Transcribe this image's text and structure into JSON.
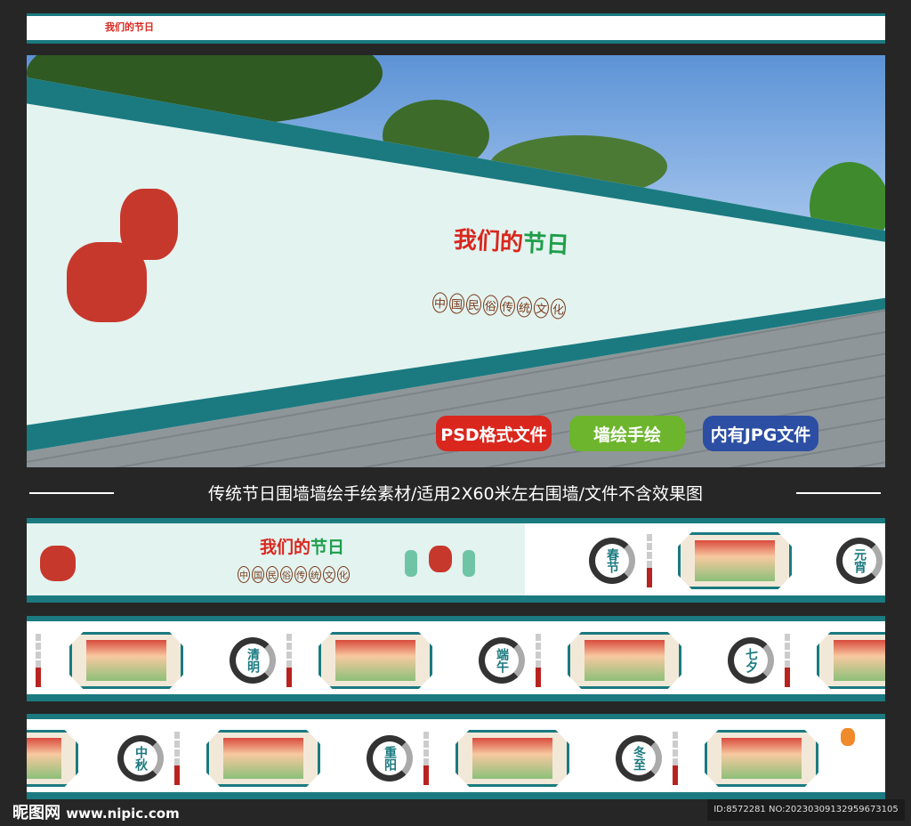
{
  "banner": {
    "title": "我们的节日",
    "title_part_red": "我们的",
    "title_part_green": "节日",
    "subtitle_chars": [
      "中",
      "国",
      "民",
      "俗",
      "传",
      "统",
      "文",
      "化"
    ]
  },
  "badges": [
    {
      "label": "PSD格式文件",
      "color": "#d9271e"
    },
    {
      "label": "墙绘手绘",
      "color": "#6cb52d"
    },
    {
      "label": "内有JPG文件",
      "color": "#2c4fa3"
    }
  ],
  "caption": "传统节日围墙墙绘手绘素材/适用2X60米左右围墙/文件不含效果图",
  "festivals": {
    "row1": [
      "春节",
      "元宵"
    ],
    "row2": [
      "清明",
      "端午",
      "七夕"
    ],
    "row3": [
      "中秋",
      "重阳",
      "冬至"
    ]
  },
  "footer": {
    "logo": "昵图网",
    "url": "www.nipic.com",
    "id_text": "ID:8572281 NO:20230309132959673105"
  },
  "colors": {
    "teal": "#1a7a80",
    "background": "#262626"
  }
}
